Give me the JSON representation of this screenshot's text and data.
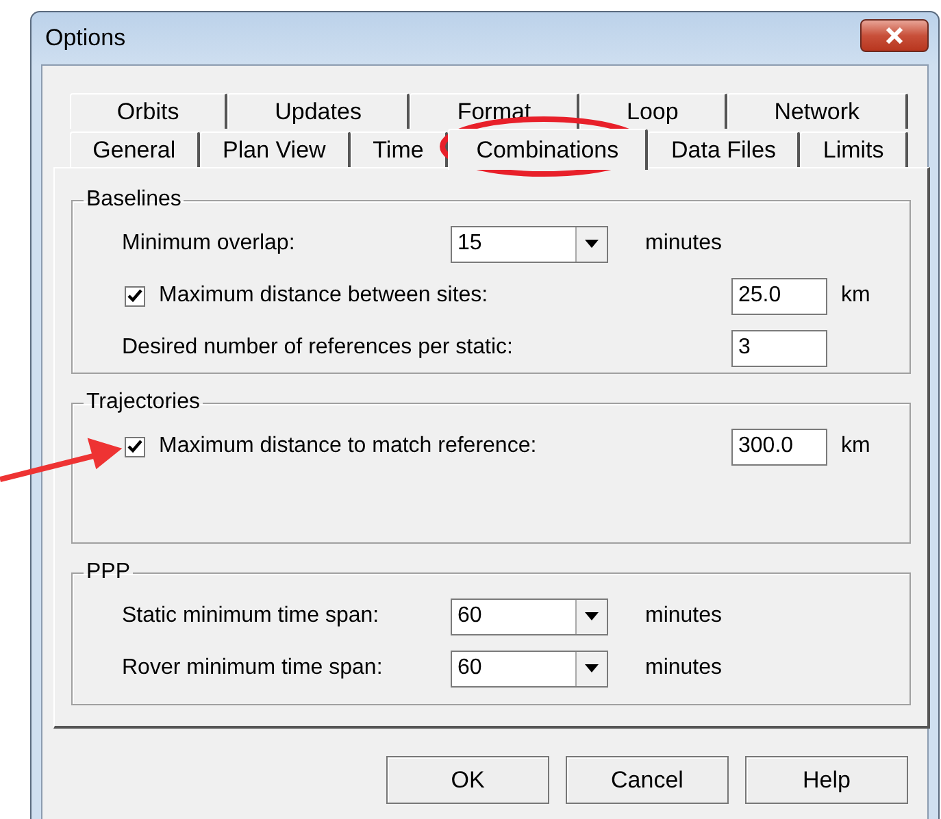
{
  "window": {
    "title": "Options"
  },
  "tab_rows": [
    {
      "tabs": [
        {
          "label": "Orbits",
          "selected": false
        },
        {
          "label": "Updates",
          "selected": false
        },
        {
          "label": "Format",
          "selected": false
        },
        {
          "label": "Loop",
          "selected": false
        },
        {
          "label": "Network",
          "selected": false
        }
      ]
    },
    {
      "tabs": [
        {
          "label": "General",
          "selected": false
        },
        {
          "label": "Plan View",
          "selected": false
        },
        {
          "label": "Time",
          "selected": false
        },
        {
          "label": "Combinations",
          "selected": true
        },
        {
          "label": "Data Files",
          "selected": false
        },
        {
          "label": "Limits",
          "selected": false
        }
      ]
    }
  ],
  "groups": [
    {
      "title": "Baselines",
      "rows": [
        {
          "kind": "select",
          "label": "Minimum overlap:",
          "value": "15",
          "unit": "minutes"
        },
        {
          "kind": "check_input",
          "checked": true,
          "label": "Maximum distance between sites:",
          "value": "25.0",
          "unit": "km"
        },
        {
          "kind": "input",
          "label": "Desired number of references per static:",
          "value": "3"
        }
      ]
    },
    {
      "title": "Trajectories",
      "rows": [
        {
          "kind": "check_input",
          "checked": true,
          "label": "Maximum distance to match reference:",
          "value": "300.0",
          "unit": "km"
        }
      ]
    },
    {
      "title": "PPP",
      "rows": [
        {
          "kind": "select",
          "label": "Static minimum time span:",
          "value": "60",
          "unit": "minutes"
        },
        {
          "kind": "select",
          "label": "Rover minimum time span:",
          "value": "60",
          "unit": "minutes"
        }
      ]
    }
  ],
  "buttons": [
    "OK",
    "Cancel",
    "Help"
  ]
}
